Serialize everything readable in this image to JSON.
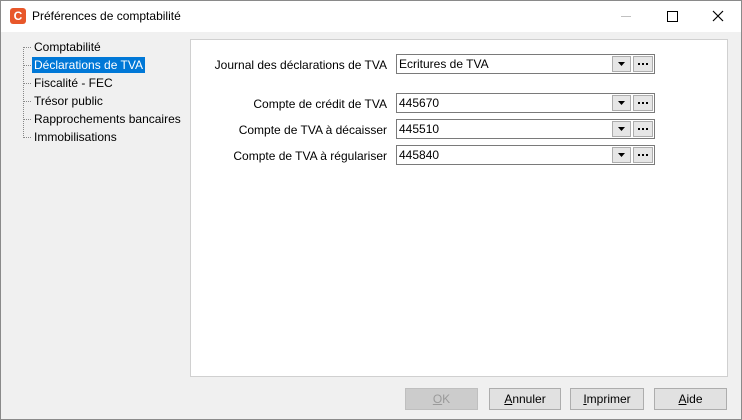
{
  "window": {
    "title": "Préférences de comptabilité",
    "app_icon_glyph": "C",
    "app_icon_color": "#e8572a",
    "controls": [
      "minimize-icon",
      "maximize-icon",
      "close-icon"
    ]
  },
  "tree": {
    "items": [
      {
        "label": "Comptabilité",
        "selected": false
      },
      {
        "label": "Déclarations de TVA",
        "selected": true
      },
      {
        "label": "Fiscalité - FEC",
        "selected": false
      },
      {
        "label": "Trésor public",
        "selected": false
      },
      {
        "label": "Rapprochements bancaires",
        "selected": false
      },
      {
        "label": "Immobilisations",
        "selected": false
      }
    ],
    "selection_color": "#0078d7"
  },
  "form": {
    "journal": {
      "label": "Journal des déclarations de TVA",
      "value": "Ecritures de TVA"
    },
    "credit": {
      "label": "Compte de crédit de TVA",
      "value": "445670"
    },
    "decaisser": {
      "label": "Compte de TVA à décaisser",
      "value": "445510"
    },
    "regulariser": {
      "label": "Compte de TVA à régulariser",
      "value": "445840"
    }
  },
  "buttons": {
    "ok": {
      "label_under": "O",
      "label_rest": "K",
      "disabled": true
    },
    "annuler": {
      "label_under": "A",
      "label_rest": "nnuler",
      "disabled": false
    },
    "imprimer": {
      "label_under": "I",
      "label_rest": "mprimer",
      "disabled": false
    },
    "aide": {
      "label_under": "A",
      "label_rest": "ide",
      "disabled": false
    }
  }
}
